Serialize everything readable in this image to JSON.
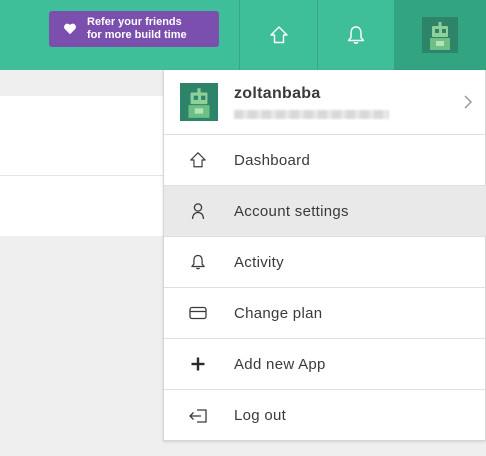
{
  "topbar": {
    "refer_line1": "Refer your friends",
    "refer_line2": "for more build time",
    "icons": [
      "heart-icon",
      "home-icon",
      "bell-icon",
      "user-avatar"
    ]
  },
  "colors": {
    "topbar": "#3fbf99",
    "refer_button": "#7b4fae",
    "active_item": "#e9e9e9"
  },
  "profile": {
    "username": "zoltanbaba"
  },
  "menu": {
    "items": [
      {
        "label": "Dashboard",
        "icon": "home-icon"
      },
      {
        "label": "Account settings",
        "icon": "user-icon",
        "active": true
      },
      {
        "label": "Activity",
        "icon": "bell-icon"
      },
      {
        "label": "Change plan",
        "icon": "credit-card-icon"
      },
      {
        "label": "Add new App",
        "icon": "plus-icon"
      },
      {
        "label": "Log out",
        "icon": "logout-icon"
      }
    ]
  }
}
